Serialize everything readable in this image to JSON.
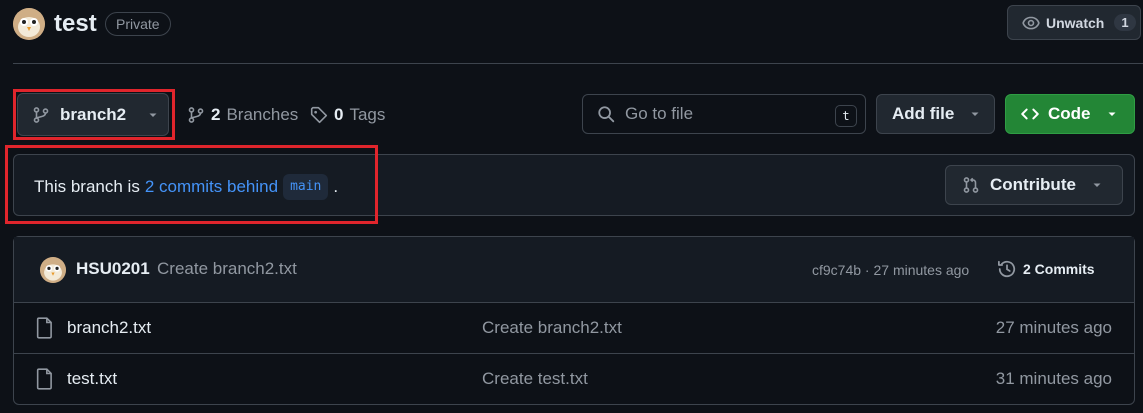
{
  "header": {
    "repo_name": "test",
    "visibility": "Private",
    "watch_label": "Unwatch",
    "watch_count": "1"
  },
  "branch_bar": {
    "current_branch": "branch2",
    "branches_count": "2",
    "branches_label": "Branches",
    "tags_count": "0",
    "tags_label": "Tags",
    "go_to_file_placeholder": "Go to file",
    "go_to_file_shortcut": "t",
    "add_file_label": "Add file",
    "code_label": "Code"
  },
  "banner": {
    "prefix": "This branch is",
    "link_text": "2 commits behind",
    "base_branch": "main",
    "suffix": ".",
    "contribute_label": "Contribute"
  },
  "latest_commit": {
    "author": "HSU0201",
    "message": "Create branch2.txt",
    "hash_and_time": "cf9c74b · 27 minutes ago",
    "commits_label": "2 Commits"
  },
  "files": [
    {
      "name": "branch2.txt",
      "commit_message": "Create branch2.txt",
      "age": "27 minutes ago"
    },
    {
      "name": "test.txt",
      "commit_message": "Create test.txt",
      "age": "31 minutes ago"
    }
  ],
  "colors": {
    "background": "#0d1117",
    "accent_blue": "#4493f8",
    "code_green": "#238636",
    "highlight_red": "#e0252c"
  },
  "icons": [
    "owl-avatar",
    "eye-icon",
    "git-branch-icon",
    "tag-icon",
    "search-icon",
    "code-icon",
    "git-pull-request-icon",
    "history-icon",
    "file-icon",
    "chevron-down-icon"
  ]
}
